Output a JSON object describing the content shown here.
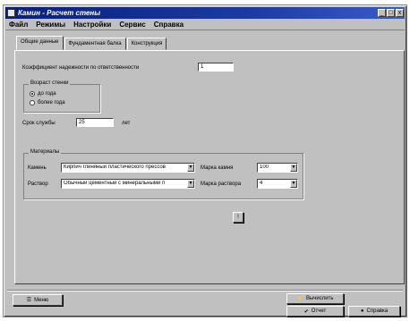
{
  "window": {
    "title": "Камин - Расчет стены"
  },
  "titlebar": {
    "min_glyph": "_",
    "max_glyph": "□",
    "close_glyph": "x"
  },
  "menu": {
    "items": [
      "Файл",
      "Режимы",
      "Настройки",
      "Сервис",
      "Справка"
    ]
  },
  "tabs": [
    "Общие данные",
    "Фундаментная балка",
    "Конструкция"
  ],
  "general": {
    "reliability_label": "Коэффициент надежности по ответственности",
    "reliability_value": "1"
  },
  "analysis": {
    "legend": "Возраст стенки",
    "options": [
      "до года",
      "более года"
    ],
    "selected": 0
  },
  "service": {
    "label": "Срок службы",
    "value": "25",
    "unit": "лет"
  },
  "materials": {
    "legend": "Материалы",
    "stone_label": "Камень",
    "stone_value": "Кирпич глиняный пластического прессов",
    "mortar_label": "Раствор",
    "mortar_value": "Обычный цементный с минеральными п",
    "stone_grade_label": "Марка камня",
    "stone_grade_value": "100",
    "mortar_grade_label": "Марка раствора",
    "mortar_grade_value": "4"
  },
  "buttons": {
    "apply_glyph": "!",
    "menu_label": "Меню",
    "calculate_label": "Вычислить",
    "report_label": "Отчет",
    "help_label": "Справка"
  }
}
